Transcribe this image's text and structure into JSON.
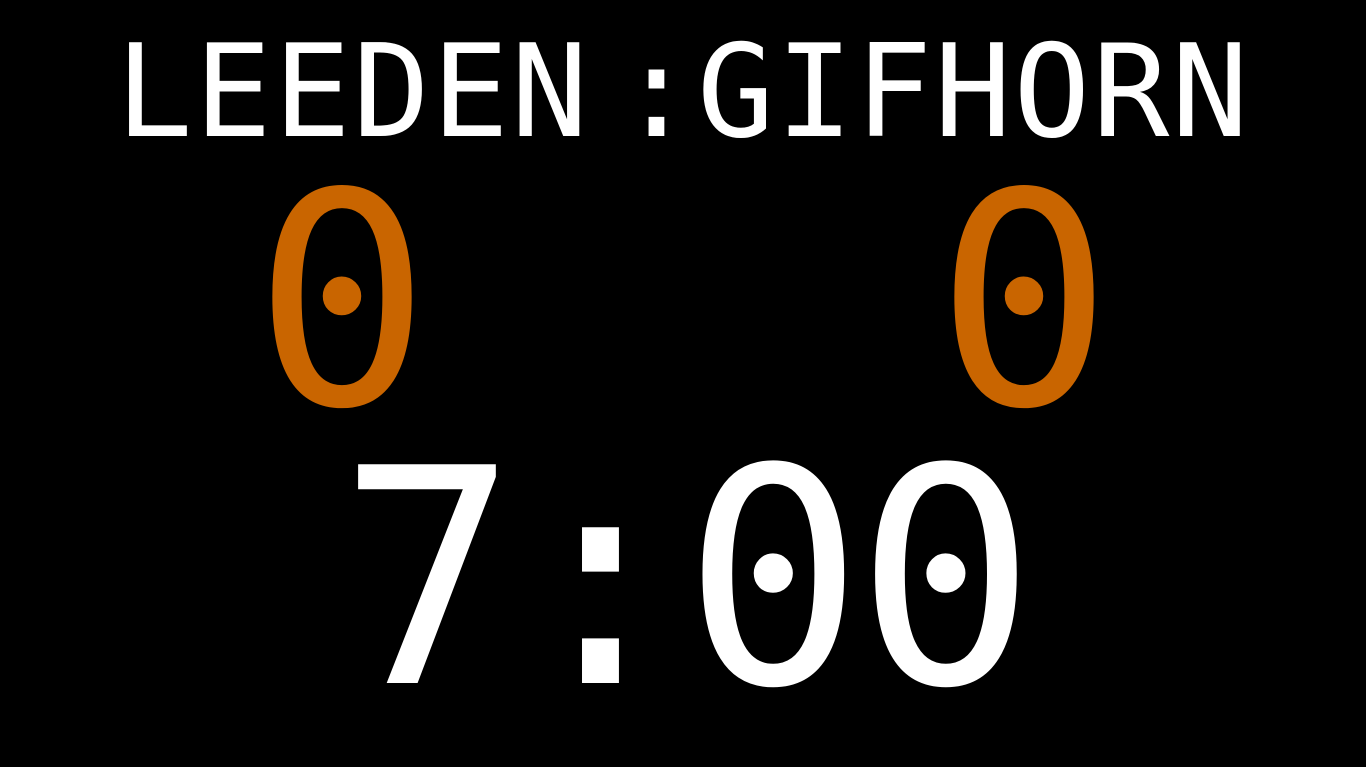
{
  "scoreboard": {
    "home_team": "LEEDEN",
    "separator": ":",
    "away_team": "GIFHORN",
    "home_score": "0",
    "away_score": "0",
    "clock": "7:00"
  },
  "colors": {
    "background": "#000000",
    "team_text": "#ffffff",
    "score_text": "#c96500",
    "clock_text": "#ffffff"
  }
}
